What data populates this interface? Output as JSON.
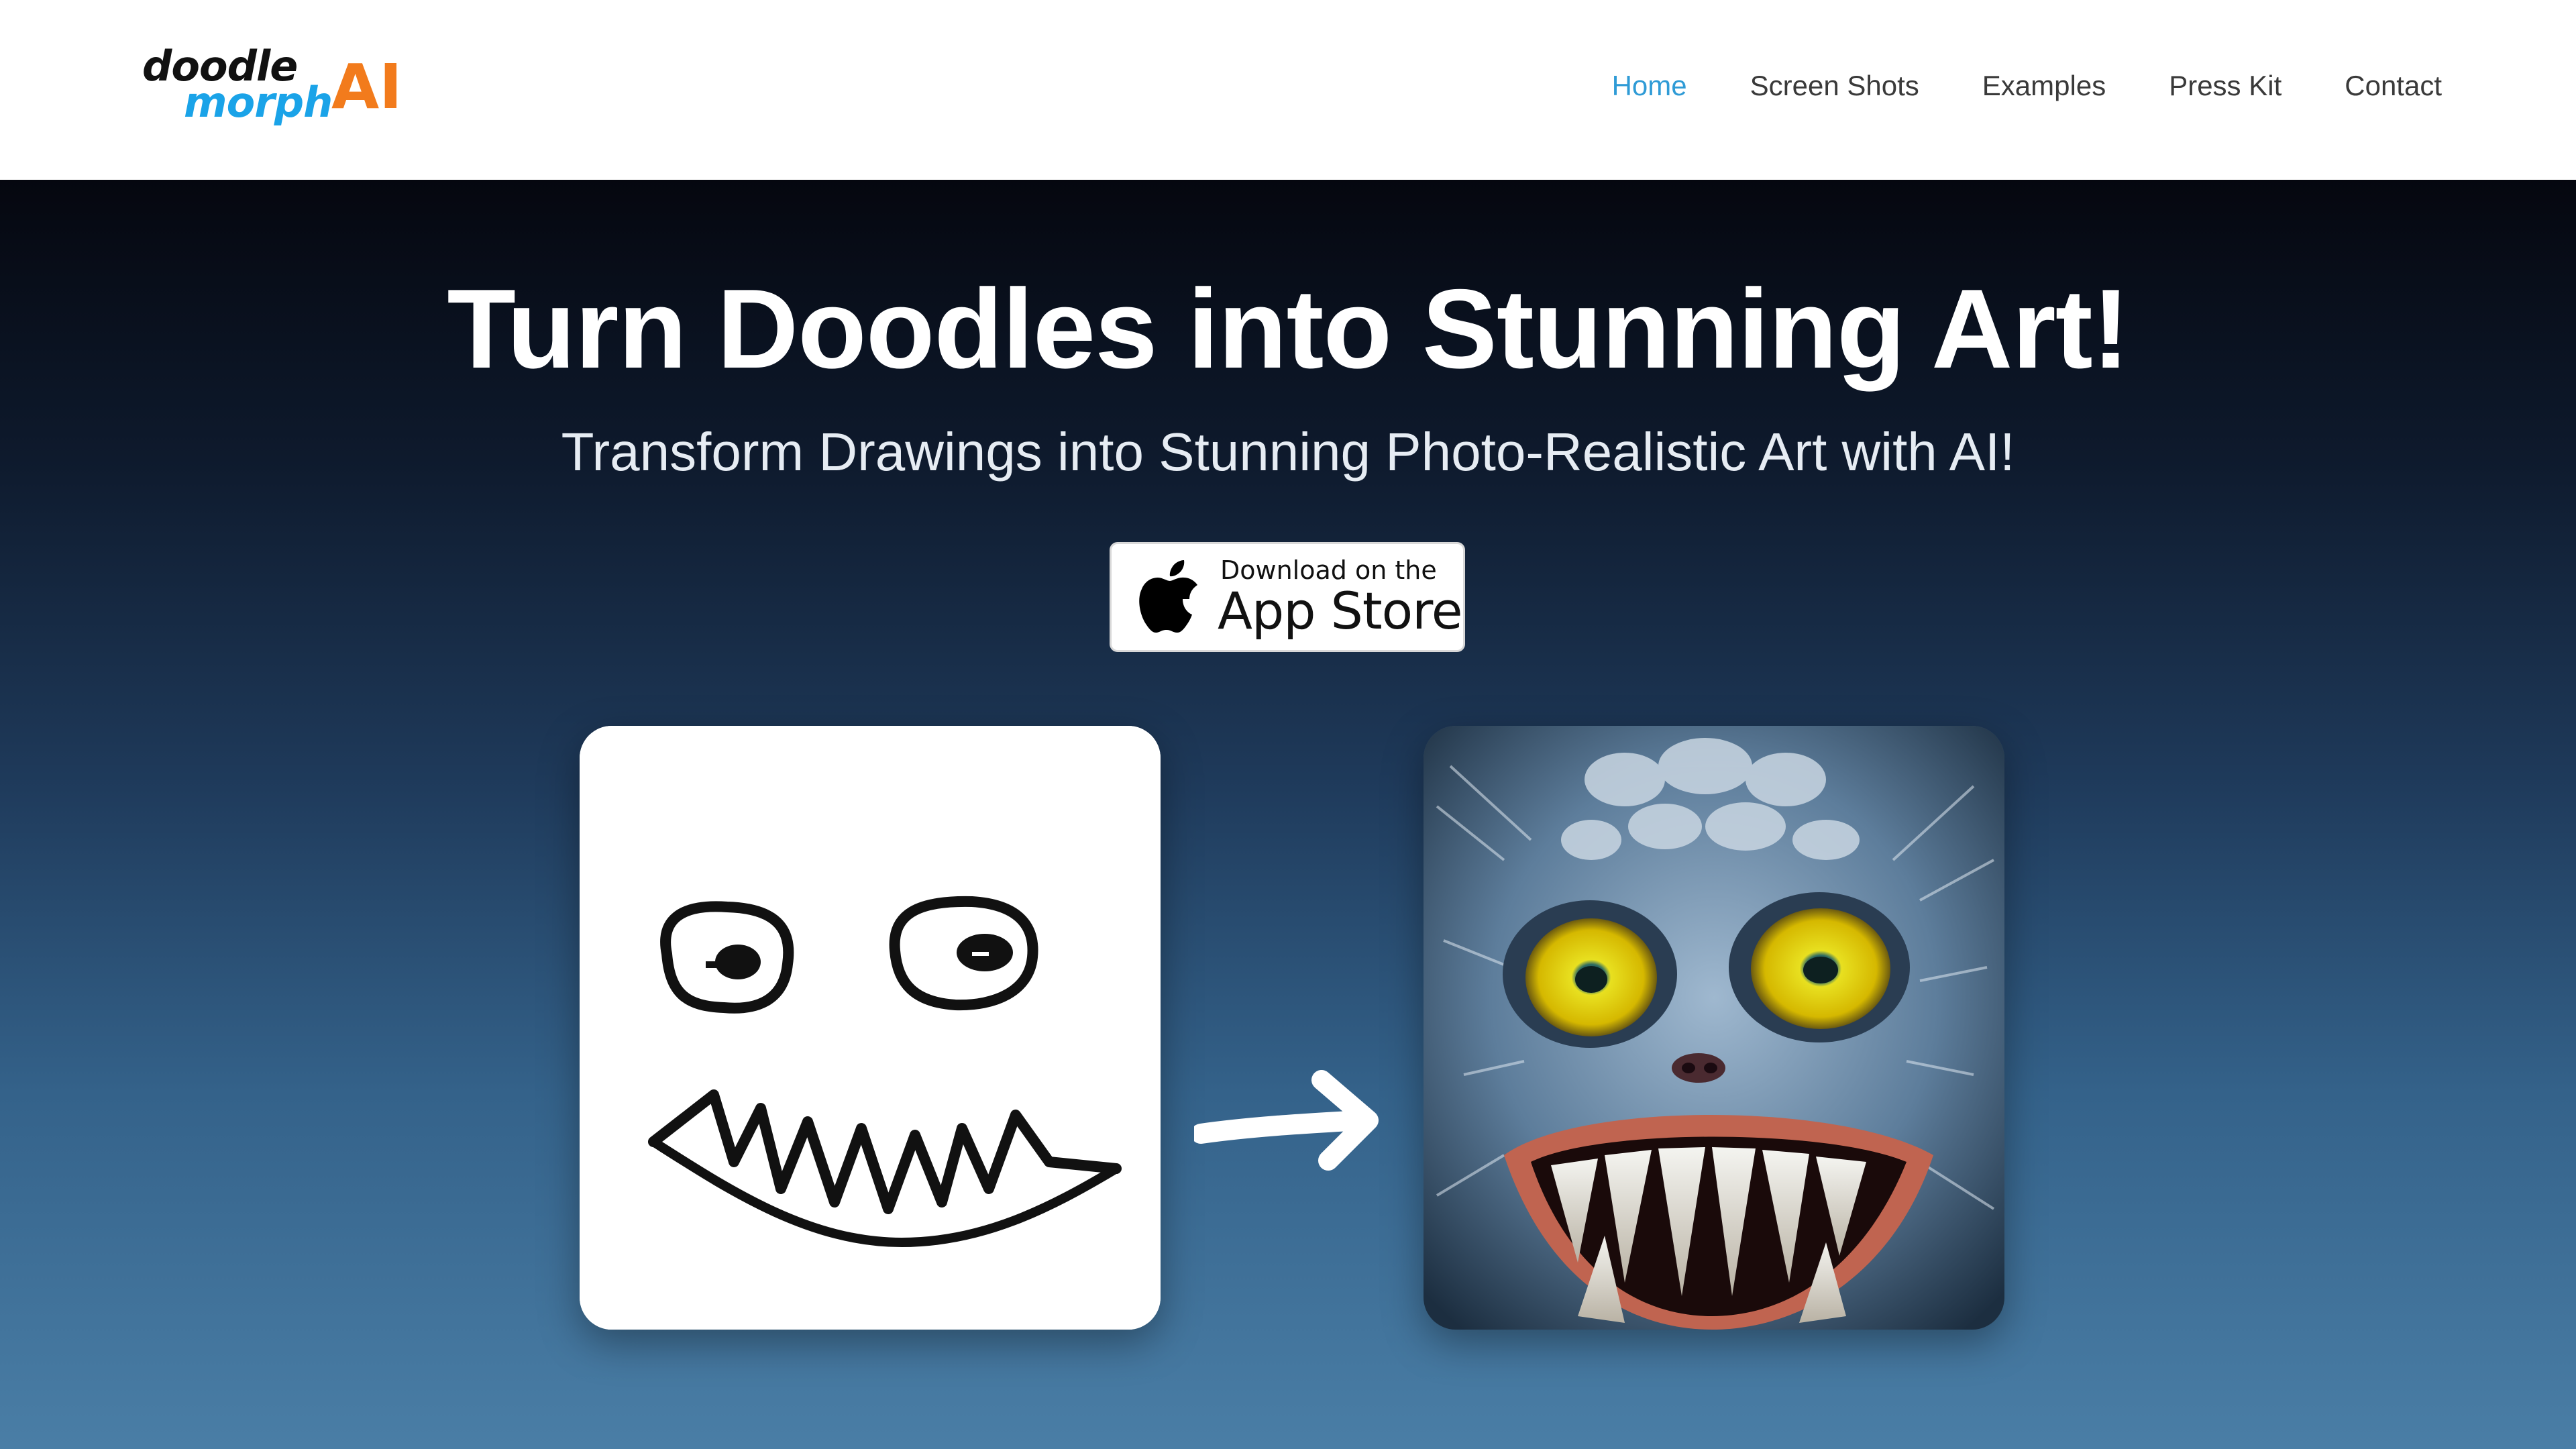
{
  "logo": {
    "word1": "doodle",
    "word2": "morph",
    "word3": "AI",
    "colors": {
      "doodle": "#111111",
      "morph": "#1aa3e8",
      "ai": "#f27b1c"
    }
  },
  "nav": {
    "items": [
      {
        "label": "Home",
        "active": true
      },
      {
        "label": "Screen Shots",
        "active": false
      },
      {
        "label": "Examples",
        "active": false
      },
      {
        "label": "Press Kit",
        "active": false
      },
      {
        "label": "Contact",
        "active": false
      }
    ],
    "active_color": "#2f9bd6"
  },
  "hero": {
    "title": "Turn Doodles into Stunning Art!",
    "subtitle": "Transform Drawings into Stunning Photo-Realistic Art with AI!",
    "appstore": {
      "small": "Download on the",
      "big": "App Store",
      "icon": "apple-icon"
    }
  },
  "showcase": {
    "before_image": "doodle-monster-face-drawing",
    "after_image": "photorealistic-blue-furry-monster",
    "arrow_icon": "arrow-right-icon"
  }
}
